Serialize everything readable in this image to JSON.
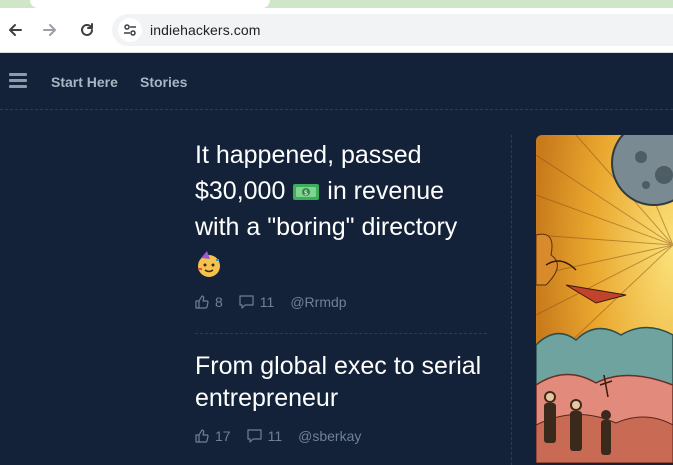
{
  "browser": {
    "url": "indiehackers.com",
    "icons": [
      "back-arrow-icon",
      "forward-arrow-icon",
      "reload-icon",
      "site-info-icon"
    ]
  },
  "nav": {
    "start_here": "Start Here",
    "stories": "Stories"
  },
  "posts": [
    {
      "title_line1": "It happened, passed",
      "title_line2a": "$30,000",
      "title_line2b": "in revenue",
      "title_line3": "with a \"boring\" directory",
      "emojis": [
        "money-emoji",
        "party-face-emoji"
      ],
      "likes": "8",
      "comments": "11",
      "author": "@Rrmdp"
    },
    {
      "title": "From global exec to serial entrepreneur",
      "likes": "17",
      "comments": "11",
      "author": "@sberkay"
    }
  ],
  "colors": {
    "background": "#132238",
    "title": "#ffffff",
    "meta": "#6f8196",
    "nav": "#aab6c3"
  }
}
